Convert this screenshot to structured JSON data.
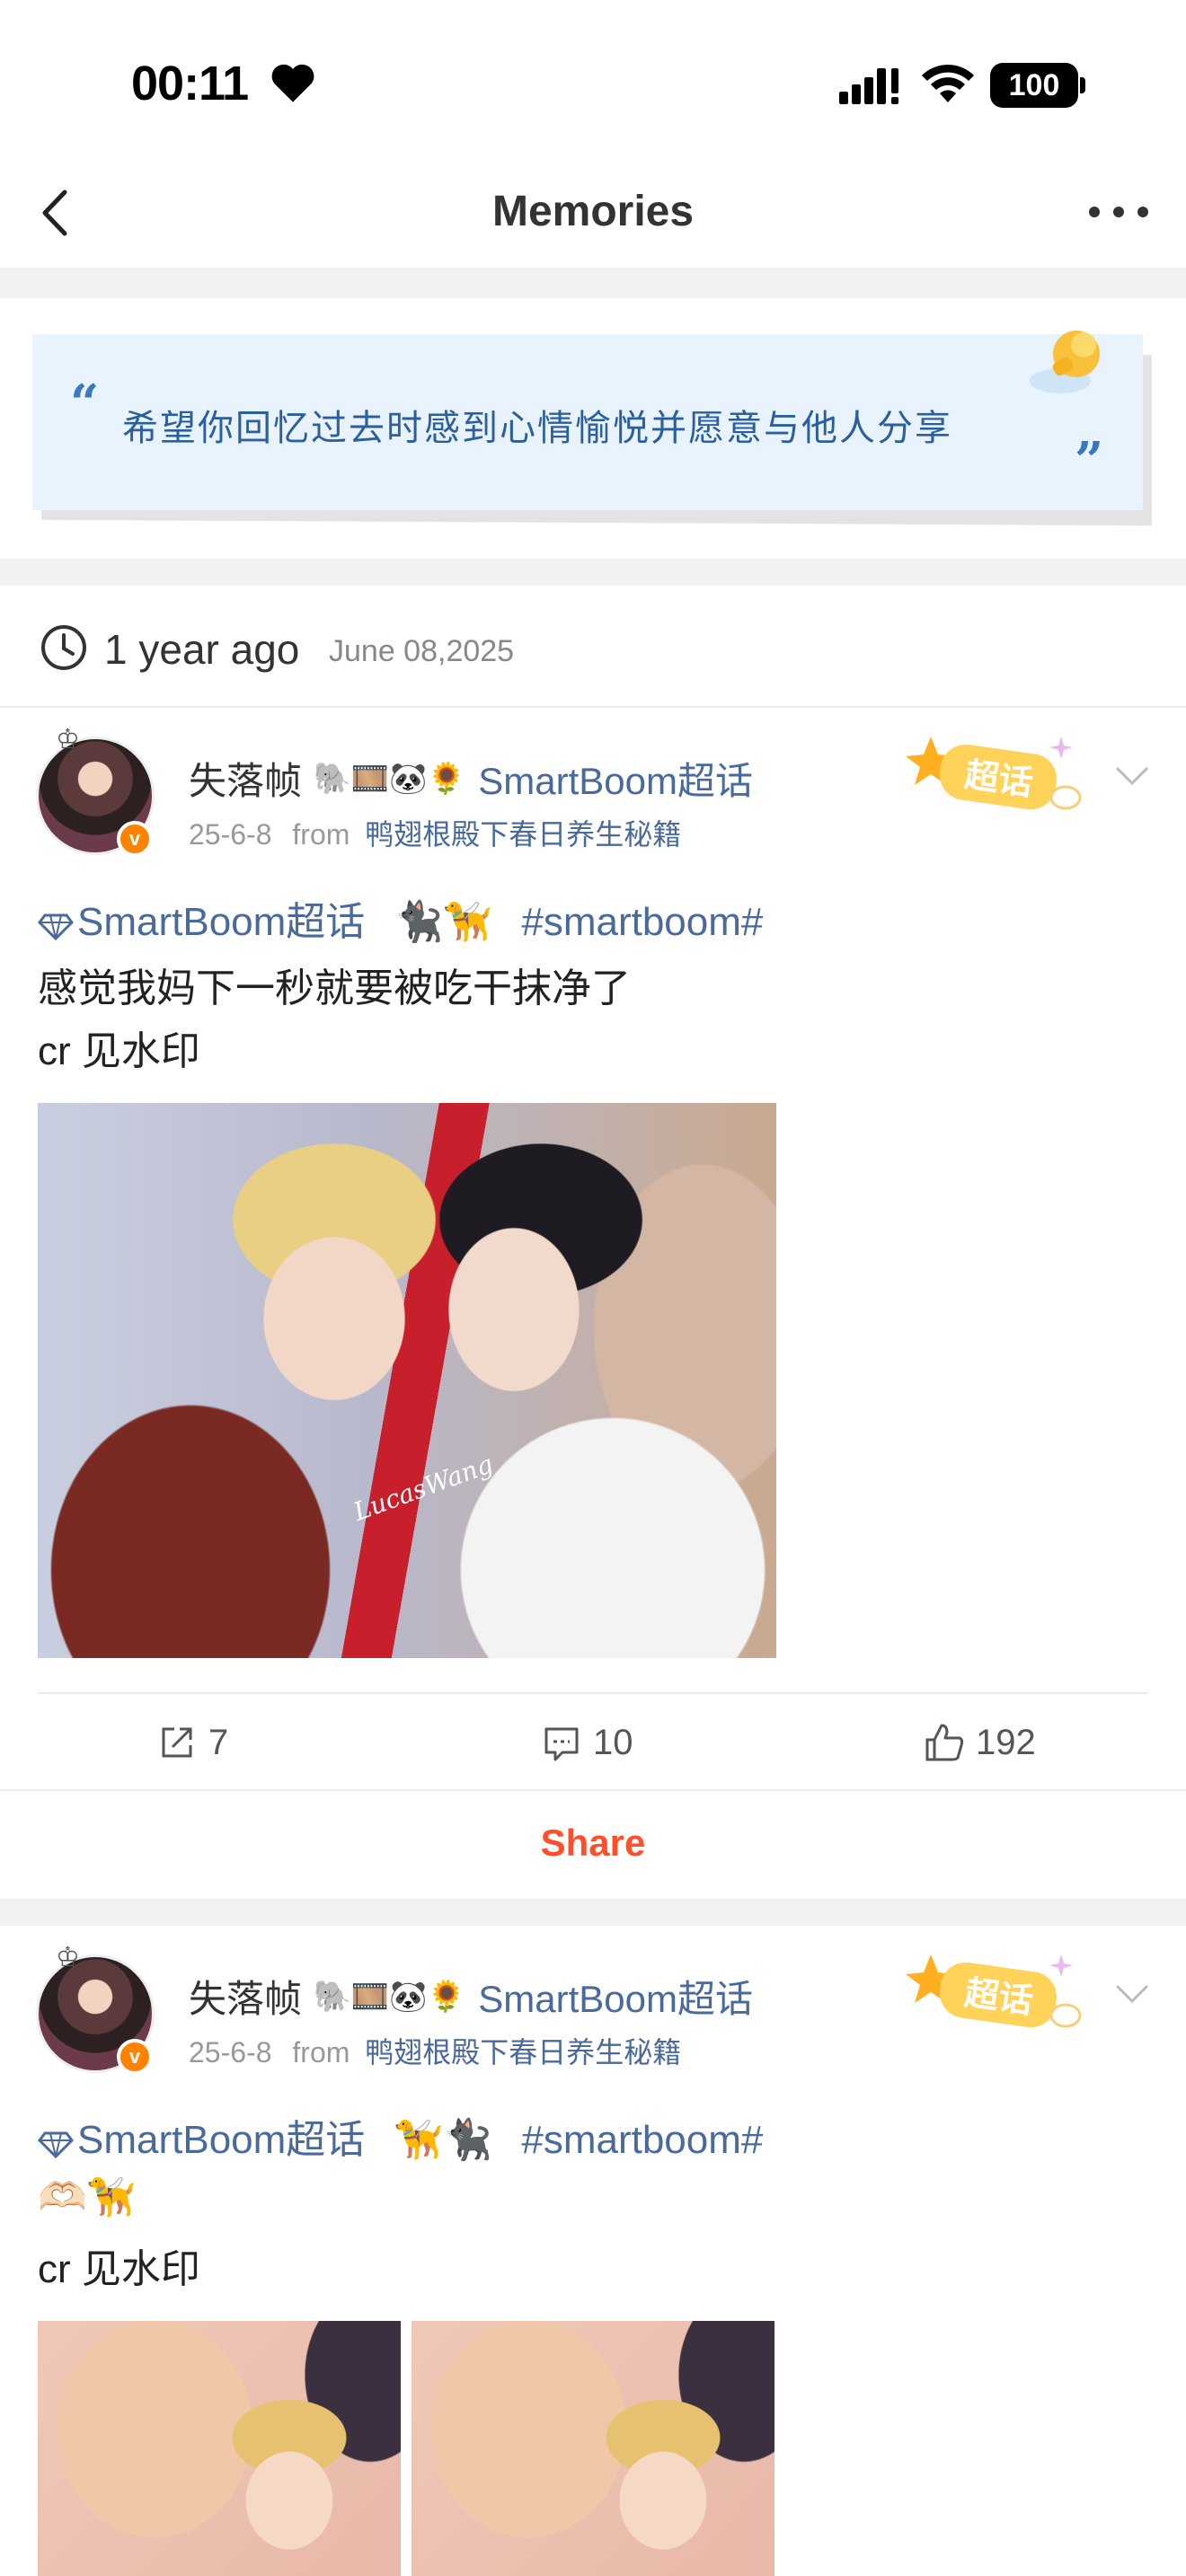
{
  "status_bar": {
    "time": "00:11",
    "heart_icon": "heart-icon",
    "battery": "100"
  },
  "nav": {
    "title": "Memories",
    "back_icon": "chevron-left-icon",
    "more_icon": "more-horizontal-icon"
  },
  "quote": {
    "open_mark": "“",
    "text": "希望你回忆过去时感到心情愉悦并愿意与他人分享",
    "close_mark": "”"
  },
  "time_row": {
    "relative": "1 year ago",
    "date": "June 08,2025"
  },
  "posts": [
    {
      "author": "失落帧",
      "author_deco": "🐘🎞️🐼🌻",
      "topic": "SmartBoom超话",
      "date": "25-6-8",
      "from_label": "from",
      "source": "鸭翅根殿下春日养生秘籍",
      "badge": "超话",
      "line1_topic": "SmartBoom超话",
      "line1_emoji": "🐈‍⬛🦮",
      "line1_hashtag": "#smartboom#",
      "line2": "感觉我妈下一秒就要被吃干抹净了",
      "line3": "cr 见水印",
      "watermark": "LucasWang",
      "reposts": "7",
      "comments": "10",
      "likes": "192",
      "share_label": "Share"
    },
    {
      "author": "失落帧",
      "author_deco": "🐘🎞️🐼🌻",
      "topic": "SmartBoom超话",
      "date": "25-6-8",
      "from_label": "from",
      "source": "鸭翅根殿下春日养生秘籍",
      "badge": "超话",
      "line1_topic": "SmartBoom超话",
      "line1_emoji": "🦮🐈‍⬛",
      "line1_hashtag": "#smartboom#",
      "line2": "🫶🏻🦮",
      "line3": "cr 见水印"
    }
  ],
  "colors": {
    "link": "#4a6a9c",
    "share": "#ff4e2a",
    "verified_badge": "#ff8200",
    "quote_bg": "#e8f3fd"
  }
}
